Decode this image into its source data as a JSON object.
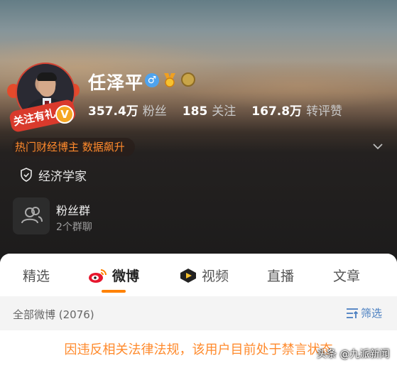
{
  "profile": {
    "name": "任泽平",
    "gender_icon": "male-icon",
    "follow_gift_label": "关注有礼",
    "verified_badge": "V",
    "stats": [
      {
        "value": "357.4万",
        "label": "粉丝"
      },
      {
        "value": "185",
        "label": "关注"
      },
      {
        "value": "167.8万",
        "label": "转评赞"
      }
    ],
    "hot_tag": "热门财经博主 数据飙升",
    "certification": "经济学家",
    "fan_group": {
      "title": "粉丝群",
      "subtitle": "2个群聊"
    }
  },
  "tabs": [
    {
      "label": "精选",
      "active": false
    },
    {
      "label": "微博",
      "active": true
    },
    {
      "label": "视频",
      "active": false
    },
    {
      "label": "直播",
      "active": false
    },
    {
      "label": "文章",
      "active": false
    }
  ],
  "feed": {
    "count_label": "全部微博 (2076)",
    "filter_label": "筛选",
    "notice": "因违反相关法律法规，该用户目前处于禁言状态"
  },
  "watermark": "头条 @九派新闻",
  "colors": {
    "accent": "#ff8200",
    "notice": "#ff8a2c",
    "link": "#4a7fc1"
  }
}
